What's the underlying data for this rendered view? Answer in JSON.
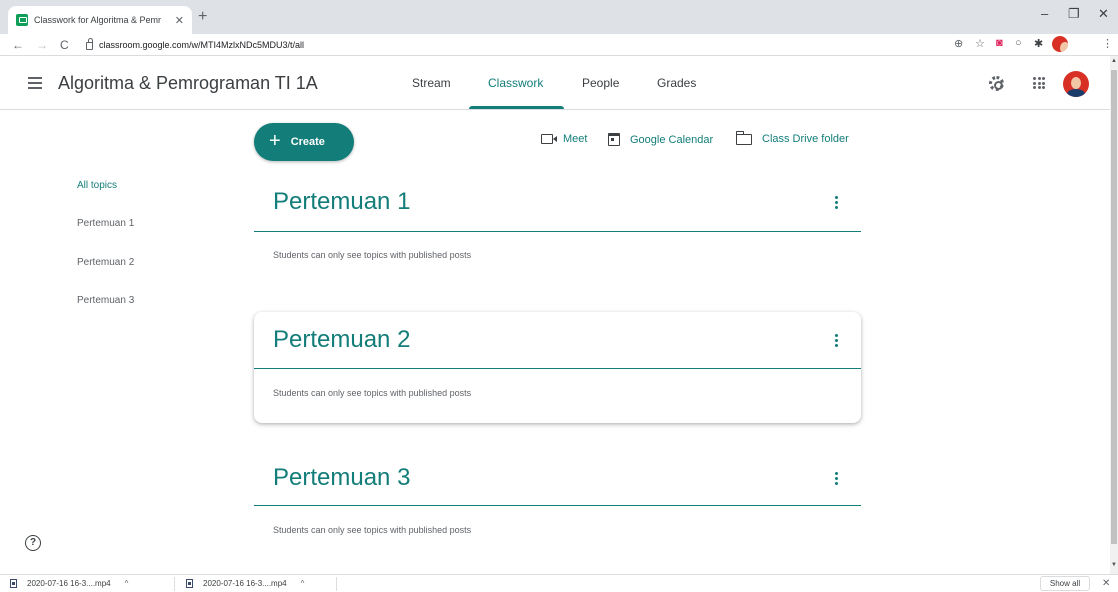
{
  "browser": {
    "tab_title": "Classwork for Algoritma & Pemr",
    "tab_close": "✕",
    "new_tab": "+",
    "url": "classroom.google.com/w/MTI4MzlxNDc5MDU3/t/all",
    "window_controls": {
      "minimize": "–",
      "restore": "❐",
      "close": "✕"
    },
    "nav": {
      "back": "←",
      "forward": "→",
      "reload": "C"
    },
    "extensions": {
      "zoom": "⊕",
      "star": "☆",
      "pocket": "◙",
      "circle": "○",
      "puzzle": "✱",
      "menu": "⋮"
    }
  },
  "header": {
    "menu_label": "Main menu",
    "class_title": "Algoritma & Pemrograman TI 1A",
    "tabs": [
      {
        "label": "Stream",
        "active": false
      },
      {
        "label": "Classwork",
        "active": true
      },
      {
        "label": "People",
        "active": false
      },
      {
        "label": "Grades",
        "active": false
      }
    ]
  },
  "toolbar": {
    "create_icon": "+",
    "create_label": "Create",
    "links": [
      {
        "label": "Meet",
        "icon": "video-camera-icon"
      },
      {
        "label": "Google Calendar",
        "icon": "calendar-icon"
      },
      {
        "label": "Class Drive folder",
        "icon": "folder-icon"
      }
    ]
  },
  "topics_nav": {
    "items": [
      {
        "label": "All topics",
        "active": true
      },
      {
        "label": "Pertemuan 1",
        "active": false
      },
      {
        "label": "Pertemuan 2",
        "active": false
      },
      {
        "label": "Pertemuan 3",
        "active": false
      }
    ]
  },
  "topics": [
    {
      "title": "Pertemuan 1",
      "note": "Students can only see topics with published posts",
      "highlighted": false
    },
    {
      "title": "Pertemuan 2",
      "note": "Students can only see topics with published posts",
      "highlighted": true
    },
    {
      "title": "Pertemuan 3",
      "note": "Students can only see topics with published posts",
      "highlighted": false
    }
  ],
  "help": {
    "icon": "?"
  },
  "downloads": {
    "items": [
      {
        "name": "2020-07-16 16-3....mp4",
        "caret": "^"
      },
      {
        "name": "2020-07-16 16-3....mp4",
        "caret": "^"
      }
    ],
    "show_all": "Show all",
    "close": "✕"
  },
  "colors": {
    "accent": "#137d79",
    "text": "#3c4043",
    "muted": "#5f6368",
    "divider": "#dadce0"
  }
}
